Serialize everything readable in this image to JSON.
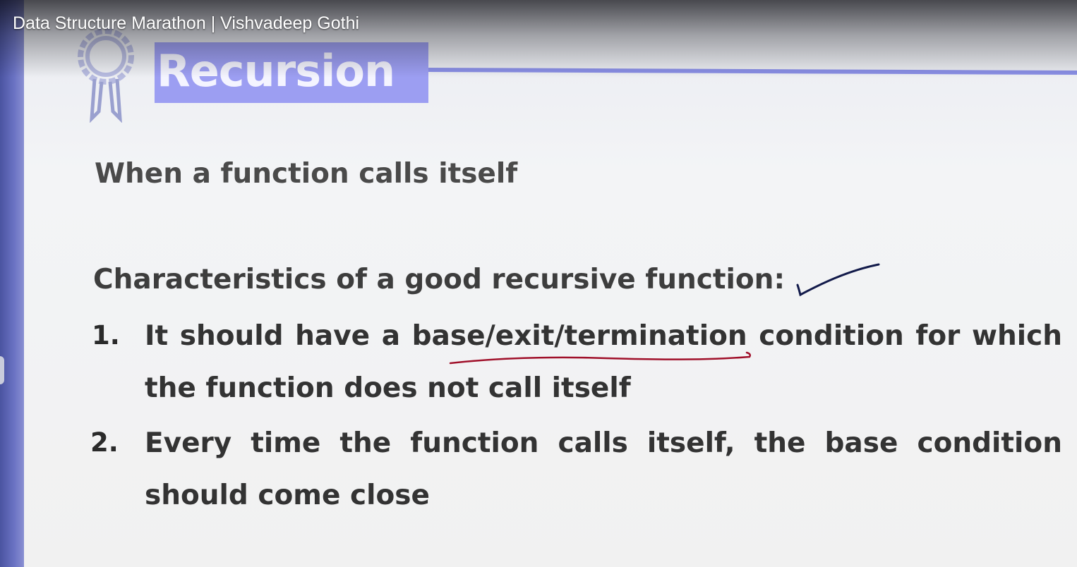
{
  "player": {
    "video_title": "Data Structure Marathon | Vishvadeep Gothi"
  },
  "slide": {
    "heading": "Recursion",
    "definition": "When a function calls itself",
    "characteristics_title": "Characteristics of a good recursive function:",
    "items": [
      {
        "number": "1.",
        "line1": "It should have a base/exit/termination condition for which",
        "line2": "the function does not call itself"
      },
      {
        "number": "2.",
        "line1": "Every time the function calls itself, the base condition",
        "line2": "should come close"
      }
    ]
  },
  "colors": {
    "heading_box": "#9c9ef2",
    "heading_rule": "#8a8fe6",
    "checkmark_ink": "#121a4a",
    "underline_ink": "#a0102a",
    "left_bar": "#5a62b4"
  },
  "icons": {
    "badge": "award-ribbon-icon",
    "annotation_check": "checkmark-icon"
  }
}
